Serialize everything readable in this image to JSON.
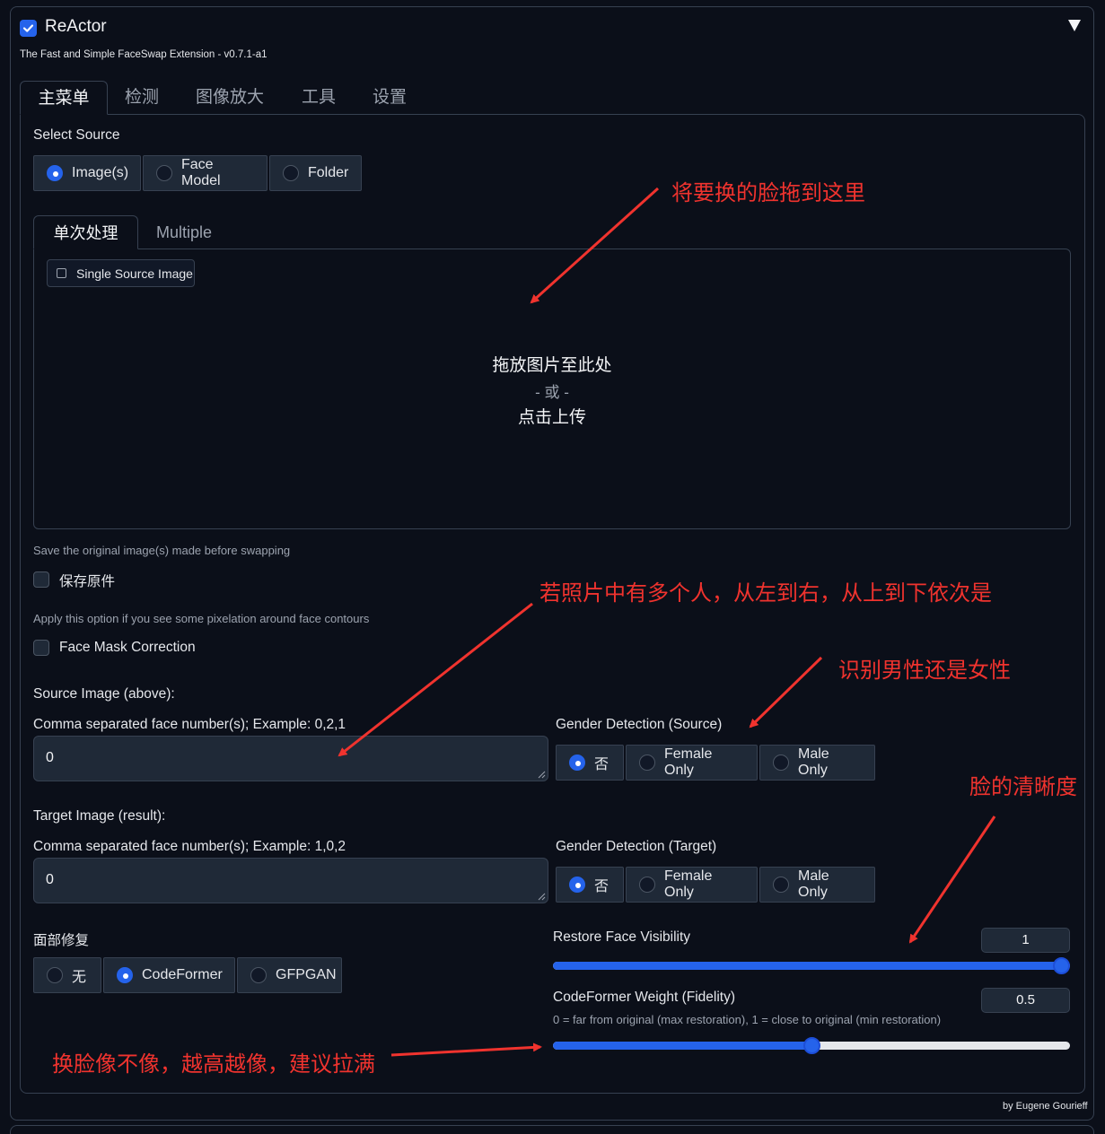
{
  "extension": {
    "title": "ReActor",
    "subtitle": "The Fast and Simple FaceSwap Extension - v0.7.1-a1",
    "enabled": true
  },
  "tabs": [
    "主菜单",
    "检测",
    "图像放大",
    "工具",
    "设置"
  ],
  "select_source": {
    "label": "Select Source",
    "options": [
      "Image(s)",
      "Face Model",
      "Folder"
    ],
    "selected": "Image(s)"
  },
  "subtabs": [
    "单次处理",
    "Multiple"
  ],
  "upload": {
    "badge": "Single Source Image",
    "drop_text": "拖放图片至此处",
    "or_text": "- 或 -",
    "click_text": "点击上传"
  },
  "save_original": {
    "info": "Save the original image(s) made before swapping",
    "label": "保存原件",
    "checked": false
  },
  "face_mask": {
    "info": "Apply this option if you see some pixelation around face contours",
    "label": "Face Mask Correction",
    "checked": false
  },
  "source_image": {
    "heading": "Source Image (above):",
    "faces_label": "Comma separated face number(s); Example: 0,2,1",
    "faces_value": "0",
    "gender_label": "Gender Detection (Source)",
    "gender_options": [
      "否",
      "Female Only",
      "Male Only"
    ],
    "gender_selected": "否"
  },
  "target_image": {
    "heading": "Target Image (result):",
    "faces_label": "Comma separated face number(s); Example: 1,0,2",
    "faces_value": "0",
    "gender_label": "Gender Detection (Target)",
    "gender_options": [
      "否",
      "Female Only",
      "Male Only"
    ],
    "gender_selected": "否"
  },
  "face_restore": {
    "label": "面部修复",
    "options": [
      "无",
      "CodeFormer",
      "GFPGAN"
    ],
    "selected": "CodeFormer"
  },
  "restore_visibility": {
    "label": "Restore Face Visibility",
    "value": "1",
    "fraction": 1.0
  },
  "codeformer_weight": {
    "label": "CodeFormer Weight (Fidelity)",
    "info": "0 = far from original (max restoration), 1 = close to original (min restoration)",
    "value": "0.5",
    "fraction": 0.5
  },
  "annotations": {
    "drag_face": "将要换的脸拖到这里",
    "multi_people": "若照片中有多个人，从左到右，从上到下依次是",
    "gender": "识别男性还是女性",
    "clarity": "脸的清晰度",
    "similarity": "换脸像不像，越高越像，建议拉满"
  },
  "footer": "by Eugene Gourieff",
  "colors": {
    "accent": "#2563eb",
    "background": "#0b0f19",
    "annotation": "#f0332e"
  }
}
